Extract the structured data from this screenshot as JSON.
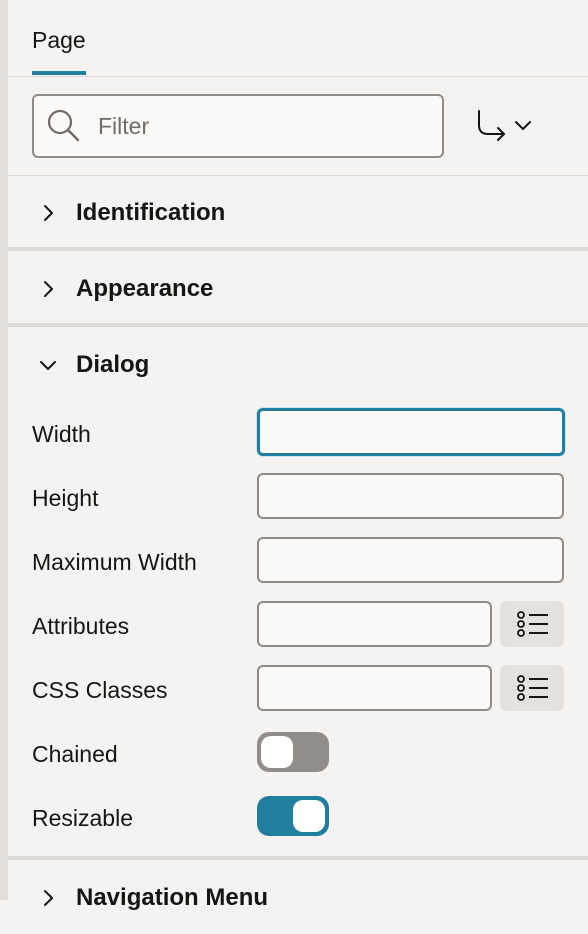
{
  "tabs": [
    {
      "label": "Page"
    }
  ],
  "filter": {
    "placeholder": "Filter",
    "value": ""
  },
  "sections": {
    "identification": {
      "title": "Identification"
    },
    "appearance": {
      "title": "Appearance"
    },
    "dialog": {
      "title": "Dialog",
      "fields": {
        "width": {
          "label": "Width",
          "value": ""
        },
        "height": {
          "label": "Height",
          "value": ""
        },
        "max_width": {
          "label": "Maximum Width",
          "value": ""
        },
        "attributes": {
          "label": "Attributes",
          "value": ""
        },
        "css_classes": {
          "label": "CSS Classes",
          "value": ""
        },
        "chained": {
          "label": "Chained",
          "on": false
        },
        "resizable": {
          "label": "Resizable",
          "on": true
        }
      }
    },
    "navigation_menu": {
      "title": "Navigation Menu"
    }
  },
  "colors": {
    "accent": "#227e9e",
    "switch_off": "#918d88",
    "background": "#f4f3f1"
  },
  "icons": {
    "search": "search-icon",
    "goto": "go-to-group-icon",
    "chevron_right": "chevron-right-icon",
    "chevron_down": "chevron-down-icon",
    "list": "list-of-values-icon"
  }
}
